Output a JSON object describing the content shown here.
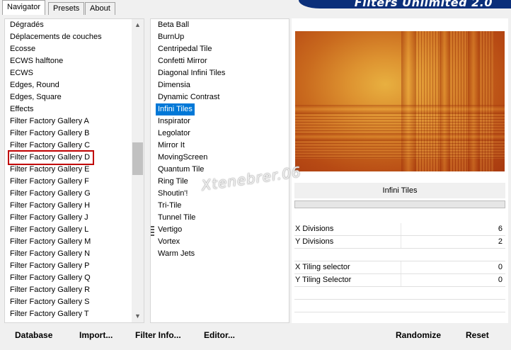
{
  "tabs": [
    "Navigator",
    "Presets",
    "About"
  ],
  "banner_title": "Filters Unlimited 2.0",
  "categories": [
    "Dégradés",
    "Déplacements de couches",
    "Ecosse",
    "ECWS halftone",
    "ECWS",
    "Edges, Round",
    "Edges, Square",
    "Effects",
    "Filter Factory Gallery A",
    "Filter Factory Gallery B",
    "Filter Factory Gallery C",
    "Filter Factory Gallery D",
    "Filter Factory Gallery E",
    "Filter Factory Gallery F",
    "Filter Factory Gallery G",
    "Filter Factory Gallery H",
    "Filter Factory Gallery J",
    "Filter Factory Gallery L",
    "Filter Factory Gallery M",
    "Filter Factory Gallery N",
    "Filter Factory Gallery P",
    "Filter Factory Gallery Q",
    "Filter Factory Gallery R",
    "Filter Factory Gallery S",
    "Filter Factory Gallery T"
  ],
  "highlighted_category_index": 11,
  "filters": [
    "Beta Ball",
    "BurnUp",
    "Centripedal Tile",
    "Confetti Mirror",
    "Diagonal Infini Tiles",
    "Dimensia",
    "Dynamic Contrast",
    "Infini Tiles",
    "Inspirator",
    "Legolator",
    "Mirror It",
    "MovingScreen",
    "Quantum Tile",
    "Ring Tile",
    "Shoutin'!",
    "Tri-Tile",
    "Tunnel Tile",
    "Vertigo",
    "Vortex",
    "Warm Jets"
  ],
  "selected_filter_index": 7,
  "watermark": "Xtenebrer.06",
  "selected_filter_name": "Infini Tiles",
  "params": [
    {
      "label": "X Divisions",
      "value": "6"
    },
    {
      "label": "Y Divisions",
      "value": "2"
    },
    {
      "label": "X Tiling selector",
      "value": "0"
    },
    {
      "label": "Y Tiling Selector",
      "value": "0"
    }
  ],
  "progress_fraction": 0,
  "buttons_left": [
    "Database",
    "Import...",
    "Filter Info...",
    "Editor..."
  ],
  "buttons_right": [
    "Randomize",
    "Reset"
  ],
  "colors": {
    "selection": "#0078d7",
    "highlight_box": "#c00000",
    "banner": "#0b2f7a",
    "preview_center": "#e8b040",
    "preview_edge": "#a83a10"
  }
}
